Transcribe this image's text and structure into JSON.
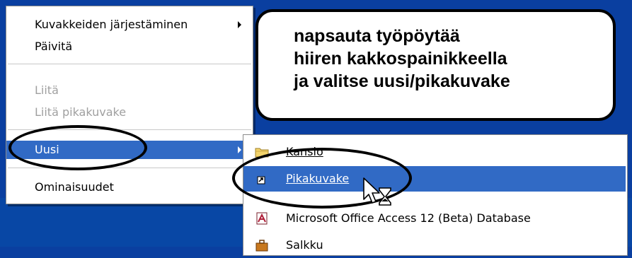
{
  "context_menu": {
    "items": [
      {
        "label": "Kuvakkeiden järjestäminen",
        "has_submenu": true,
        "disabled": false,
        "selected": false
      },
      {
        "label": "Päivitä",
        "has_submenu": false,
        "disabled": false,
        "selected": false
      },
      {
        "label": "Liitä",
        "has_submenu": false,
        "disabled": true,
        "selected": false
      },
      {
        "label": "Liitä pikakuvake",
        "has_submenu": false,
        "disabled": true,
        "selected": false
      },
      {
        "label": "Uusi",
        "has_submenu": true,
        "disabled": false,
        "selected": true
      },
      {
        "label": "Ominaisuudet",
        "has_submenu": false,
        "disabled": false,
        "selected": false
      }
    ]
  },
  "submenu": {
    "items": [
      {
        "label": "Kansio",
        "icon": "folder-icon",
        "selected": false
      },
      {
        "label": "Pikakuvake",
        "icon": "shortcut-icon",
        "selected": true
      },
      {
        "label": "Microsoft Office Access 12 (Beta) Database",
        "icon": "access-database-icon",
        "selected": false
      },
      {
        "label": "Salkku",
        "icon": "briefcase-icon",
        "selected": false
      }
    ]
  },
  "instruction": {
    "lines": [
      "napsauta työpöytää",
      "hiiren kakkospainikkeella",
      "ja valitse uusi/pikakuvake"
    ]
  },
  "colors": {
    "selection": "#316ac5",
    "desktop": "#0a3fa0",
    "disabled_text": "#a0a0a0"
  }
}
